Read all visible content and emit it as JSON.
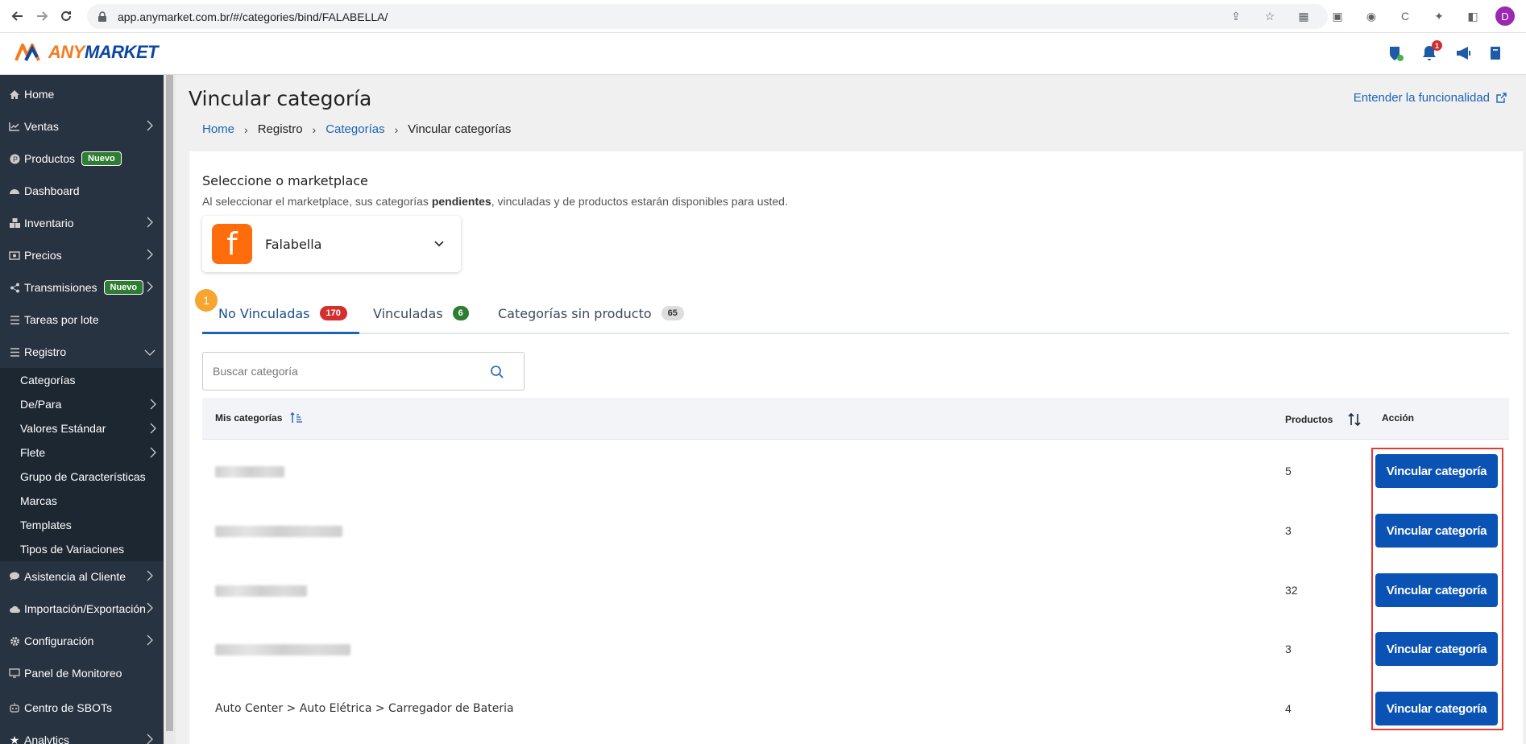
{
  "browser": {
    "url": "app.anymarket.com.br/#/categories/bind/FALABELLA/",
    "profile_initial": "D"
  },
  "header": {
    "logo_any": "ANY",
    "logo_market": "MARKET",
    "notification_count": "1",
    "colors": {
      "brand_orange": "#f47b20",
      "brand_blue": "#0d47a1"
    }
  },
  "sidebar": {
    "items": [
      {
        "label": "Home",
        "icon": "home-icon",
        "expandable": false
      },
      {
        "label": "Ventas",
        "icon": "chart-line-icon",
        "expandable": true
      },
      {
        "label": "Productos",
        "icon": "product-icon",
        "badge": "Nuevo"
      },
      {
        "label": "Dashboard",
        "icon": "dashboard-icon"
      },
      {
        "label": "Inventario",
        "icon": "cubes-icon",
        "expandable": true
      },
      {
        "label": "Precios",
        "icon": "money-icon",
        "expandable": true
      },
      {
        "label": "Transmisiones",
        "icon": "share-icon",
        "badge": "Nuevo",
        "expandable": true
      },
      {
        "label": "Tareas por lote",
        "icon": "list-icon"
      },
      {
        "label": "Registro",
        "icon": "list-icon",
        "expanded": true
      },
      {
        "label": "Asistencia al Cliente",
        "icon": "chat-icon",
        "expandable": true
      },
      {
        "label": "Importación/Exportación",
        "icon": "cloud-icon",
        "expandable": true
      },
      {
        "label": "Configuración",
        "icon": "gear-icon",
        "expandable": true
      },
      {
        "label": "Panel de Monitoreo",
        "icon": "monitor-icon"
      },
      {
        "label": "Centro de SBOTs",
        "icon": "robot-icon"
      },
      {
        "label": "Analytics",
        "icon": "star-icon",
        "expandable": true
      }
    ],
    "submenu": [
      {
        "label": "Categorías"
      },
      {
        "label": "De/Para",
        "expandable": true
      },
      {
        "label": "Valores Estándar",
        "expandable": true
      },
      {
        "label": "Flete",
        "expandable": true
      },
      {
        "label": "Grupo de Características"
      },
      {
        "label": "Marcas"
      },
      {
        "label": "Templates"
      },
      {
        "label": "Tipos de Variaciones"
      }
    ]
  },
  "page": {
    "title": "Vincular categoría",
    "help_link": "Entender la funcionalidad",
    "breadcrumb": [
      "Home",
      "Registro",
      "Categorías",
      "Vincular categorías"
    ]
  },
  "marketplace": {
    "title": "Seleccione o marketplace",
    "desc_prefix": "Al seleccionar el marketplace, sus categorías ",
    "desc_bold": "pendientes",
    "desc_suffix": ", vinculadas y de productos estarán disponibles para usted.",
    "selected": "Falabella",
    "logo_letter": "f"
  },
  "tabs": [
    {
      "label": "No Vinculadas",
      "count": "170",
      "active": true
    },
    {
      "label": "Vinculadas",
      "count": "6"
    },
    {
      "label": "Categorías sin producto",
      "count": "65"
    }
  ],
  "step_marker": "1",
  "search": {
    "placeholder": "Buscar categoría",
    "value": ""
  },
  "table": {
    "columns": [
      "Mis categorías",
      "Productos",
      "Acción"
    ],
    "rows": [
      {
        "category": "",
        "products": "5",
        "action": "Vincular categoría"
      },
      {
        "category": "",
        "products": "3",
        "action": "Vincular categoría"
      },
      {
        "category": "",
        "products": "32",
        "action": "Vincular categoría"
      },
      {
        "category": "",
        "products": "3",
        "action": "Vincular categoría"
      },
      {
        "category": "Auto Center > Auto Elétrica > Carregador de Bateria",
        "products": "4",
        "action": "Vincular categoría"
      }
    ]
  }
}
